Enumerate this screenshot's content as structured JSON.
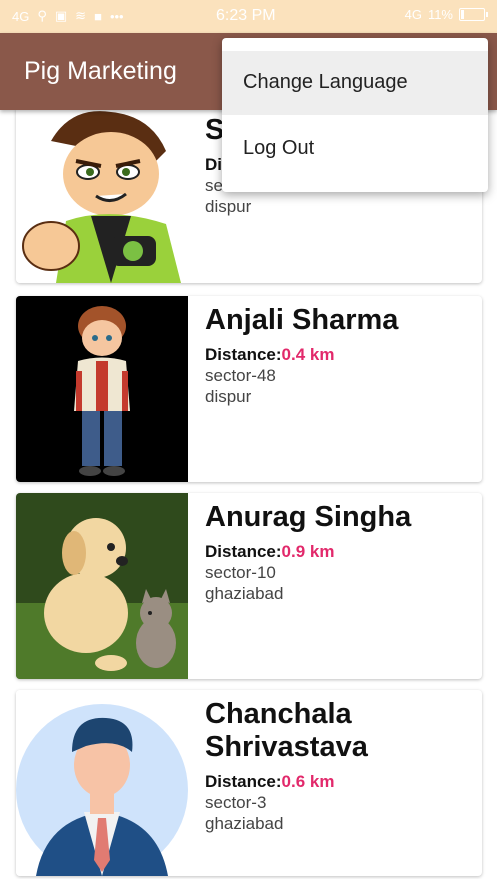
{
  "status_bar": {
    "left_network": "4G",
    "time": "6:23 PM",
    "right_network": "4G",
    "battery": "11%",
    "battery_level": 0.11
  },
  "app_bar": {
    "title": "Pig Marketing"
  },
  "menu": {
    "items": [
      {
        "label": "Change Language"
      },
      {
        "label": "Log Out"
      }
    ]
  },
  "list": {
    "distance_label": "Distance:",
    "items": [
      {
        "name": "S",
        "name_line2": "",
        "distance_label": "Di",
        "distance": "",
        "sector": "sect",
        "city": "dispur"
      },
      {
        "name": "Anjali Sharma",
        "name_line2": "",
        "distance": "0.4 km",
        "sector": "sector-48",
        "city": "dispur"
      },
      {
        "name": "Anurag Singha",
        "name_line2": "",
        "distance": "0.9 km",
        "sector": "sector-10",
        "city": "ghaziabad"
      },
      {
        "name": "Chanchala",
        "name_line2": "Shrivastava",
        "distance": "0.6 km",
        "sector": "sector-3",
        "city": "ghaziabad"
      }
    ]
  }
}
